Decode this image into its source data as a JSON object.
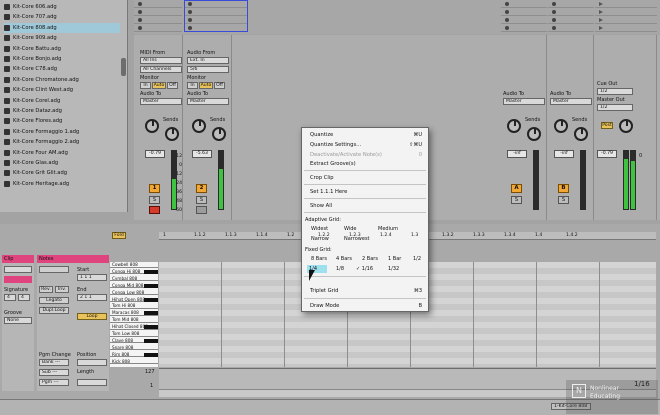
{
  "browser": {
    "items": [
      "Kit-Core 606.adg",
      "Kit-Core 707.adg",
      "Kit-Core 808.adg",
      "Kit-Core 909.adg",
      "Kit-Core Battu.adg",
      "Kit-Core Bonjo.adg",
      "Kit-Core C78.adg",
      "Kit-Core Chromatone.adg",
      "Kit-Core Clint West.adg",
      "Kit-Core Corel.adg",
      "Kit-Core Dataz.adg",
      "Kit-Core Flores.adg",
      "Kit-Core Formaggio 1.adg",
      "Kit-Core Formaggio 2.adg",
      "Kit-Core Four AM.adg",
      "Kit-Core Glas.adg",
      "Kit-Core Grit Glit.adg",
      "Kit-Core Heritage.adg"
    ],
    "selected_index": 2
  },
  "mixer": {
    "midi_from_label": "MIDI From",
    "midi_from_value": "All Ins",
    "midi_channel_value": "All Channels",
    "audio_from_label": "Audio From",
    "audio_from_value": "Ext. In",
    "audio_from_channel": "5/6",
    "monitor_label": "Monitor",
    "monitor_in": "In",
    "monitor_auto": "Auto",
    "monitor_off": "Off",
    "audio_to_label": "Audio To",
    "audio_to_value": "Master",
    "sends_label": "Sends",
    "track1_volume": "-0.79",
    "track2_volume": "-5.63",
    "track1_number": "1",
    "track2_number": "2",
    "solo": "S",
    "scale": [
      "12",
      "0",
      "12",
      "24",
      "36",
      "48",
      "60"
    ],
    "right_strips": [
      {
        "audio_to_label": "Audio To",
        "audio_to_value": "Master",
        "volume": "-inf",
        "number": "A",
        "solo": "S"
      },
      {
        "audio_to_label": "Audio To",
        "audio_to_value": "Master",
        "volume": "-inf",
        "number": "B",
        "solo": "S"
      }
    ],
    "master": {
      "cue_out_label": "Cue Out",
      "cue_out_value": "1/2",
      "master_out_label": "Master Out",
      "master_out_value": "1/2",
      "post_label": "Post",
      "volume": "-0.79",
      "volume2": "0"
    },
    "colors": {
      "track_button": "#f2a634",
      "arm_red": "#d43b2a",
      "meter_green": "#3fc23f",
      "selection_blue": "#3a4bd8"
    }
  },
  "detail": {
    "fold_label": "Fold",
    "ruler": [
      "1",
      "1.1.2",
      "1.1.3",
      "1.1.4",
      "1.2",
      "1.2.2",
      "1.2.3",
      "1.2.4",
      "1.3",
      "1.3.2",
      "1.3.3",
      "1.3.4",
      "1.4",
      "1.4.2"
    ],
    "clip_tab_label": "Clip",
    "notes_tab_label": "Notes",
    "signature_label": "Signature",
    "signature_num": "4",
    "signature_den": "4",
    "groove_label": "Groove",
    "groove_value": "None",
    "start_label": "Start",
    "end_label": "End",
    "start_value": "1  1  1",
    "end_value": "2  1  1",
    "rev_label": "Rev.",
    "inv_label": "Inv.",
    "legato_label": "Legato",
    "dupl_loop_label": "Dupl.Loop",
    "loop_label": "Loop",
    "position_label": "Position",
    "length_label": "Length",
    "pgm_change_label": "Pgm Change",
    "bank_value": "Bank ---",
    "sub_value": "Sub ---",
    "pgm_value": "Pgm ---",
    "keys": [
      "Cowbell 808",
      "Conga Hi 808",
      "Cymbal 808",
      "Conga Mid 808",
      "Conga Low 808",
      "Hihat Open 808",
      "Tom Hi 808",
      "Maracas 808",
      "Tom Mid 808",
      "Hihat Closed 808",
      "Tom Low 808",
      "Clave 808",
      "Snare 808",
      "Rim 808",
      "Kick 808"
    ],
    "velocity_max": "127",
    "velocity_min": "1",
    "grid_display": "1/16",
    "status_bar_value": "1-Kit-Core 808"
  },
  "menu": {
    "items": [
      {
        "label": "Quantize",
        "shortcut": "⌘U",
        "disabled": false
      },
      {
        "label": "Quantize Settings...",
        "shortcut": "⇧⌘U",
        "disabled": false
      },
      {
        "label": "Deactivate/Activate Note(s)",
        "shortcut": "0",
        "disabled": true
      },
      {
        "label": "Extract Groove(s)",
        "shortcut": "",
        "disabled": false
      },
      {
        "label": "Crop Clip",
        "shortcut": "",
        "disabled": false
      },
      {
        "label": "Set 1.1.1 Here",
        "shortcut": "",
        "disabled": false
      },
      {
        "label": "Show All",
        "shortcut": "",
        "disabled": false
      }
    ],
    "adaptive_grid_label": "Adaptive Grid:",
    "adaptive": [
      "Widest",
      "Wide",
      "Medium",
      "Narrow",
      "Narrowest"
    ],
    "fixed_grid_label": "Fixed Grid:",
    "fixed_row1": [
      "8 Bars",
      "4 Bars",
      "2 Bars",
      "1 Bar",
      "1/2"
    ],
    "fixed_row2": [
      "1/4",
      "1/8",
      "✓ 1/16",
      "1/32"
    ],
    "triplet_label": "Triplet Grid",
    "triplet_shortcut": "⌘3",
    "draw_mode_label": "Draw Mode",
    "draw_mode_shortcut": "B"
  },
  "watermark": {
    "line1": "Nonlinear",
    "line2": "Educating"
  }
}
